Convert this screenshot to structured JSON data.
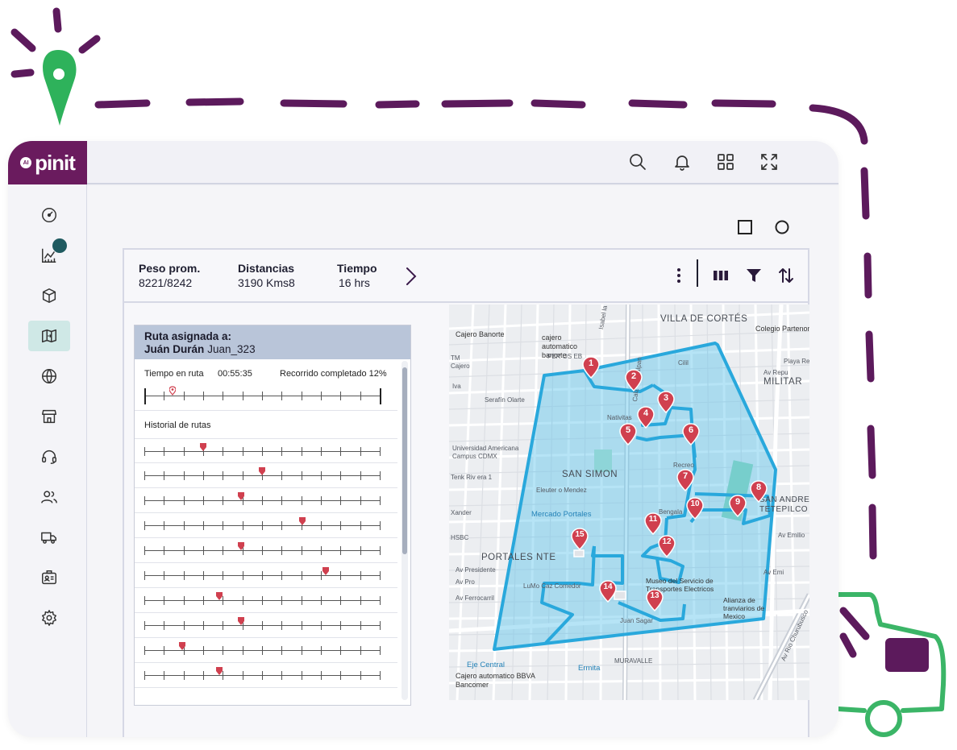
{
  "brand": {
    "logo_prefix": "AI",
    "logo_text": "pinit"
  },
  "topbar": {
    "icons": [
      "search-icon",
      "bell-icon",
      "apps-grid-icon",
      "fullscreen-icon"
    ]
  },
  "sidebar": {
    "items": [
      {
        "icon": "dashboard-gauge-icon"
      },
      {
        "icon": "analytics-chart-icon",
        "has_notification": true
      },
      {
        "icon": "package-box-icon"
      },
      {
        "icon": "route-map-icon",
        "active": true
      },
      {
        "icon": "globe-icon"
      },
      {
        "icon": "store-icon"
      },
      {
        "icon": "headset-icon"
      },
      {
        "icon": "users-icon"
      },
      {
        "icon": "truck-icon"
      },
      {
        "icon": "id-card-icon"
      },
      {
        "icon": "settings-gear-icon"
      }
    ]
  },
  "window_controls": [
    "square-icon",
    "circle-icon"
  ],
  "stats": [
    {
      "label": "Peso prom.",
      "value": "8221/8242"
    },
    {
      "label": "Distancias",
      "value": "3190 Kms8"
    },
    {
      "label": "Tiempo",
      "value": "16 hrs"
    }
  ],
  "toolbar": {
    "icons": [
      "more-vertical-icon",
      "columns-icon",
      "filter-icon",
      "sort-icon"
    ]
  },
  "route_card": {
    "title": "Ruta asignada a:",
    "driver_name": "Juán Durán",
    "driver_user": "Juan_323",
    "time_label": "Tiempo en ruta",
    "time_value": "00:55:35",
    "progress_label": "Recorrido completado 12%",
    "progress": 0.12,
    "history_title": "Historial de rutas",
    "history": [
      0.25,
      0.5,
      0.41,
      0.67,
      0.41,
      0.77,
      0.32,
      0.41,
      0.16,
      0.32
    ]
  },
  "map": {
    "accent": "#29a8dc",
    "pin_color": "#d0404f",
    "districts": [
      "VILLA DE CORTÉS",
      "MILITAR",
      "SAN SIMON",
      "PORTALES NTE",
      "SAN ANDRES",
      "TETEPILCO"
    ],
    "pois": [
      "Cajero Banorte",
      "cajero automatico banorte",
      "Colegio Partenon",
      "Nativitas",
      "Mercado Portales",
      "LuMo Caz Comedor",
      "Museo del Servicio de Transportes Electricos",
      "Alianza de tranviarios de Mexico",
      "Cajero automatico BBVA Bancomer",
      "Eje Central",
      "Ermita",
      "MURAVALLE"
    ],
    "streets": [
      "PER OS EB",
      "Isabel la Católica",
      "TM",
      "Cajero",
      "Serafín Olarte",
      "Iva",
      "Universidad Americana Campus CDMX",
      "Tenk Riv era 1",
      "Xander",
      "Eleuter o Mendez",
      "HSBC",
      "Av Repu",
      "Av Emilio",
      "Av Presidente",
      "Av Pro",
      "Av Emi",
      "Av Ferrocarril",
      "Calz de Tlalpan",
      "Juan Sagar",
      "Bengala",
      "Cilil",
      "Recreo",
      "Playa Re",
      "Av Rio Churubusco"
    ],
    "stops": [
      "1",
      "2",
      "3",
      "4",
      "5",
      "6",
      "7",
      "8",
      "9",
      "10",
      "11",
      "12",
      "13",
      "14",
      "15"
    ]
  }
}
